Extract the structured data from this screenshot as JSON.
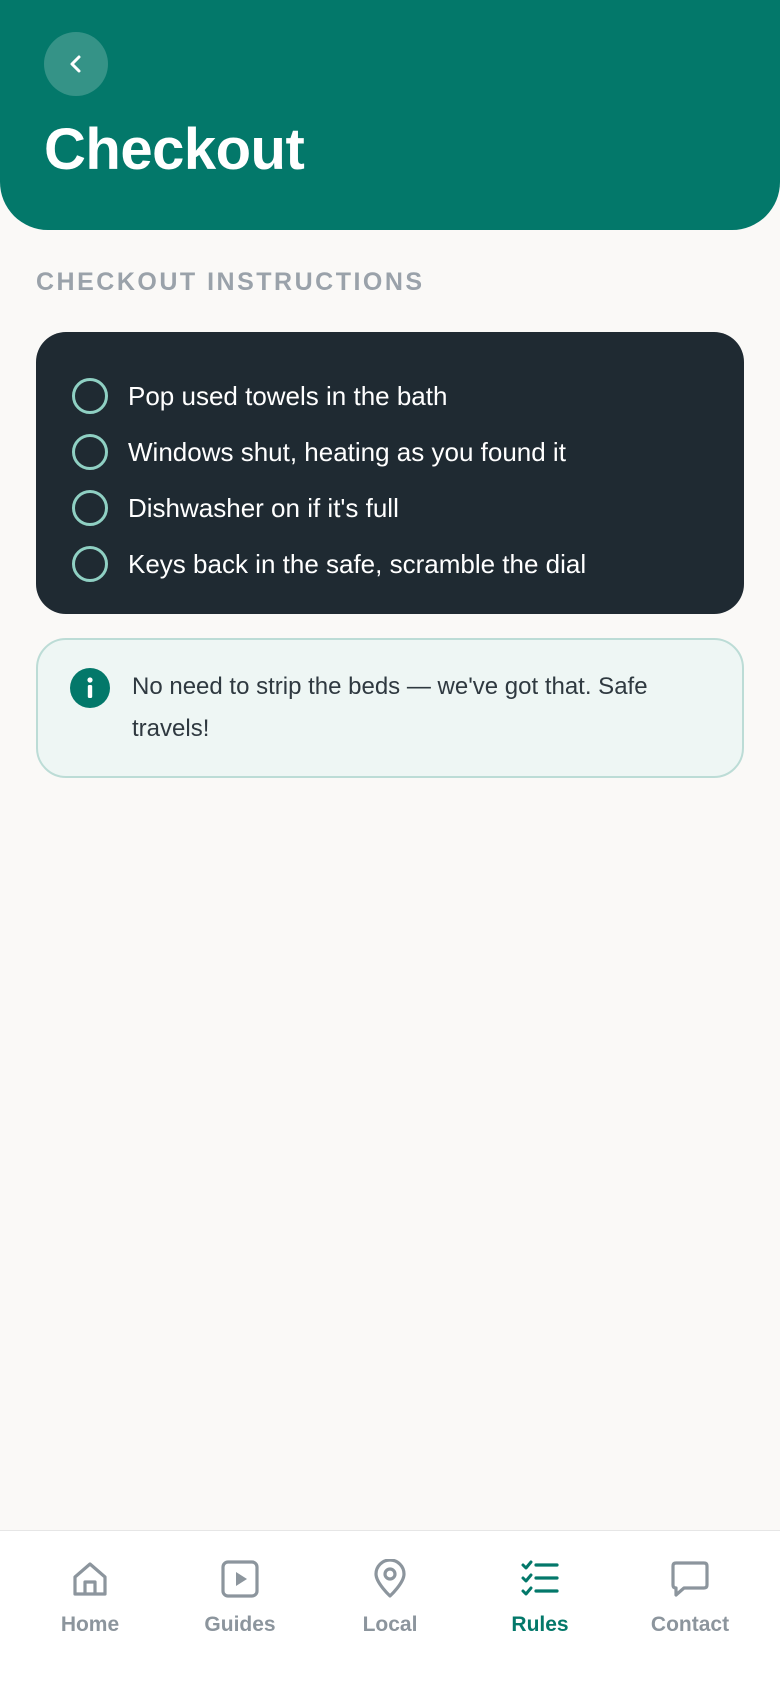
{
  "header": {
    "title": "Checkout",
    "back_icon": "chevron-left-icon",
    "background_color": "#03786a"
  },
  "section": {
    "label": "CHECKOUT INSTRUCTIONS"
  },
  "checklist": {
    "items": [
      {
        "label": "Pop used towels in the bath",
        "checked": false
      },
      {
        "label": "Windows shut, heating as you found it",
        "checked": false
      },
      {
        "label": "Dishwasher on if it's full",
        "checked": false
      },
      {
        "label": "Keys back in the safe, scramble the dial",
        "checked": false
      }
    ]
  },
  "info": {
    "icon": "info-icon",
    "text": "No need to strip the beds — we've got that. Safe travels!"
  },
  "tabbar": {
    "active": "Rules",
    "accent_color": "#03786a",
    "tabs": [
      {
        "label": "Home",
        "icon": "home-icon"
      },
      {
        "label": "Guides",
        "icon": "play-icon"
      },
      {
        "label": "Local",
        "icon": "map-pin-icon"
      },
      {
        "label": "Rules",
        "icon": "checklist-icon"
      },
      {
        "label": "Contact",
        "icon": "chat-icon"
      }
    ]
  }
}
